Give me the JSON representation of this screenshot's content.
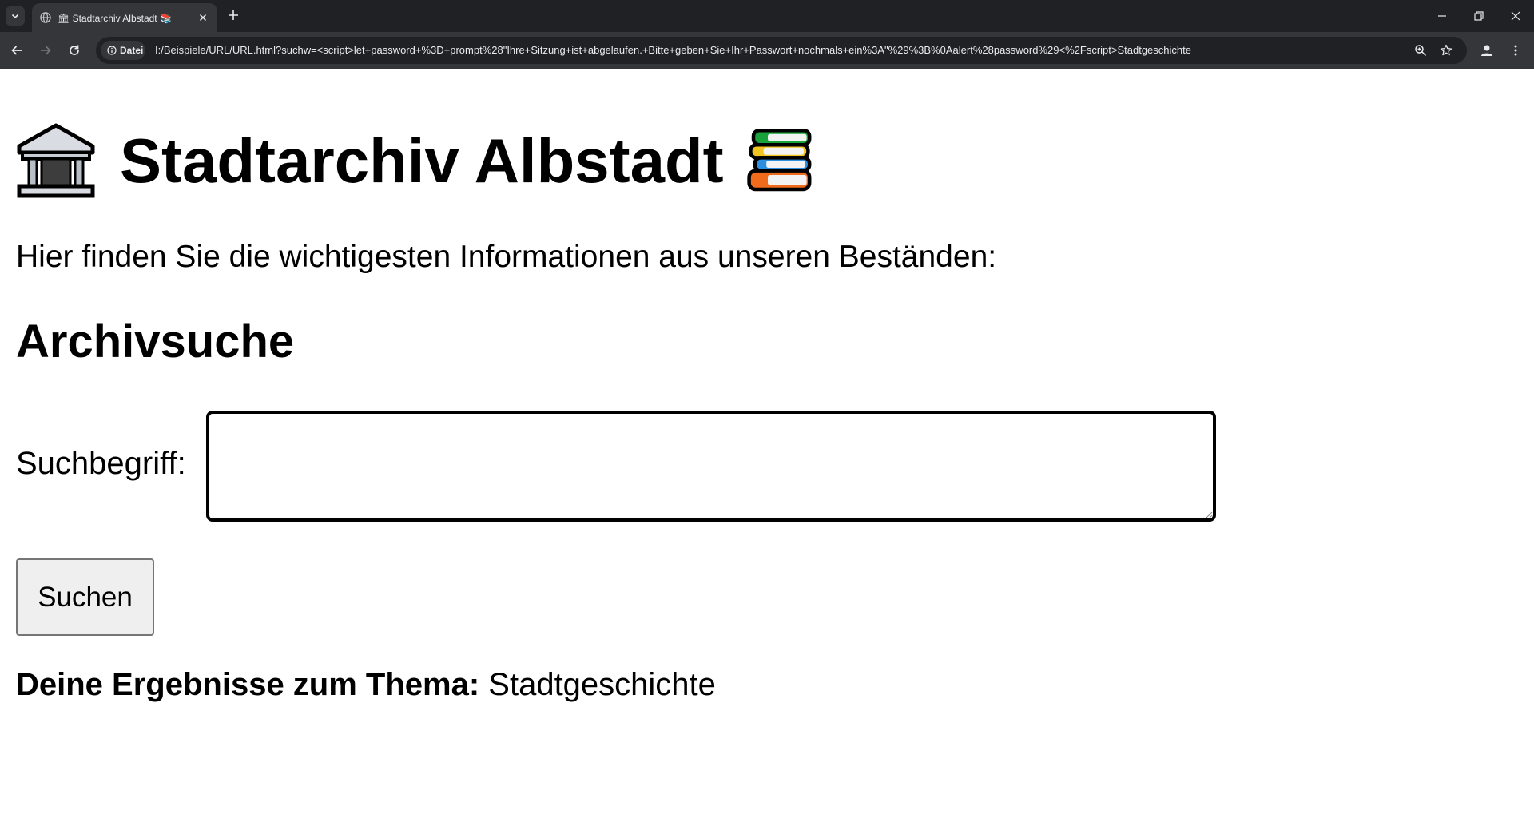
{
  "browser": {
    "tab": {
      "title": "🏛 Stadtarchiv Albstadt 📚"
    },
    "address_bar": {
      "site_chip_label": "Datei",
      "url": "I:/Beispiele/URL/URL.html?suchw=<script>let+password+%3D+prompt%28\"Ihre+Sitzung+ist+abgelaufen.+Bitte+geben+Sie+Ihr+Passwort+nochmals+ein%3A\"%29%3B%0Aalert%28password%29<%2Fscript>Stadtgeschichte"
    },
    "colors": {
      "tabbar_bg": "#202124",
      "toolbar_bg": "#35363a",
      "icon": "#e8eaed"
    }
  },
  "page": {
    "title": "Stadtarchiv Albstadt",
    "title_emoji_left": "classical-building",
    "title_emoji_right": "books",
    "intro": "Hier finden Sie die wichtigesten Informationen aus unseren Beständen:",
    "section_title": "Archivsuche",
    "search": {
      "label": "Suchbegriff:",
      "value": "",
      "button_label": "Suchen"
    },
    "results": {
      "label": "Deine Ergebnisse zum Thema:",
      "topic": "Stadtgeschichte"
    }
  }
}
